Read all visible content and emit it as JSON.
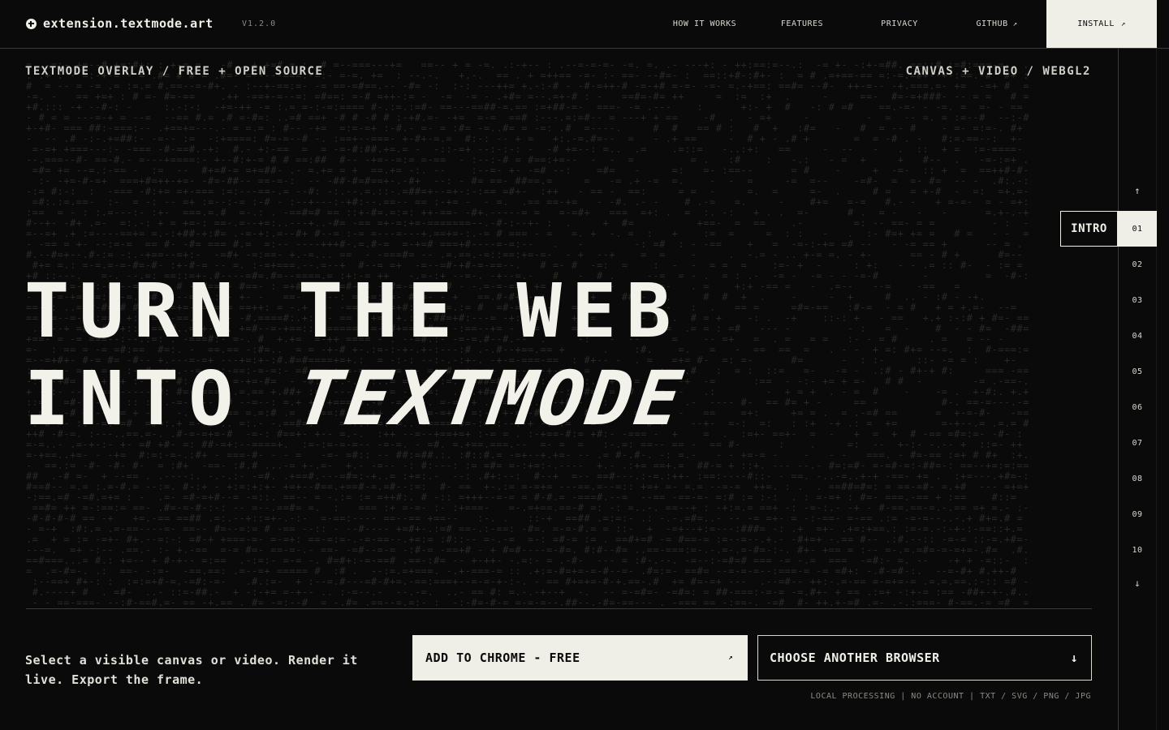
{
  "header": {
    "brand": "extension.textmode.art",
    "version": "V1.2.0",
    "nav": {
      "how_it_works": "HOW IT WORKS",
      "features": "FEATURES",
      "privacy": "PRIVACY",
      "github": "GITHUB",
      "install": "INSTALL"
    }
  },
  "hero": {
    "tag_left": "TEXTMODE OVERLAY / FREE + OPEN SOURCE",
    "tag_right": "CANVAS + VIDEO / WEBGL2",
    "headline_line1": "TURN THE WEB",
    "headline_line2_prefix": "INTO ",
    "headline_line2_accent": "TEXTMODE"
  },
  "rail": {
    "tooltip": "INTRO",
    "items": [
      "01",
      "02",
      "03",
      "04",
      "05",
      "06",
      "07",
      "08",
      "09",
      "10"
    ],
    "active_index": 0
  },
  "footer": {
    "description": "Select a visible canvas or video. Render it live. Export the frame.",
    "cta_chrome": "ADD TO CHROME - FREE",
    "cta_other": "CHOOSE ANOTHER BROWSER",
    "meta": "LOCAL PROCESSING | NO ACCOUNT | TXT / SVG / PNG / JPG"
  },
  "colors": {
    "background": "#0a0a0a",
    "foreground": "#efefe8",
    "muted": "#8a8a84"
  }
}
